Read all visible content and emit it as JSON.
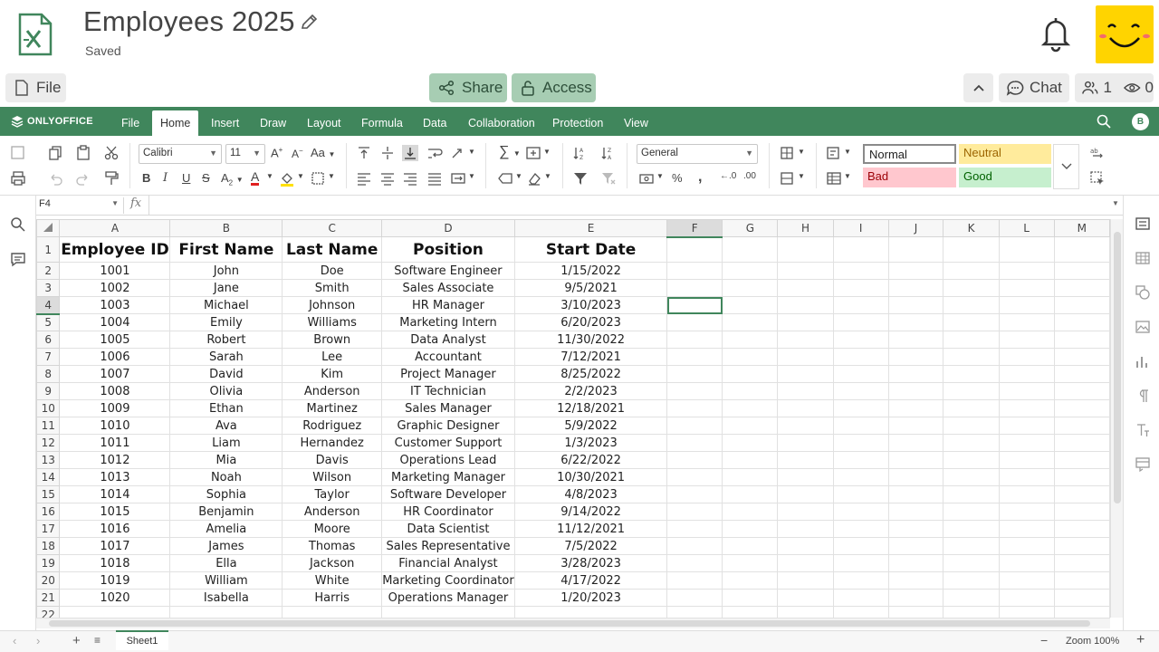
{
  "header": {
    "title": "Employees 2025",
    "status": "Saved",
    "file_label": "File",
    "share_label": "Share",
    "access_label": "Access",
    "chat_label": "Chat",
    "users_count": "1",
    "viewers_count": "0"
  },
  "menu": {
    "brand": "ONLYOFFICE",
    "tabs": [
      "File",
      "Home",
      "Insert",
      "Draw",
      "Layout",
      "Formula",
      "Data",
      "Collaboration",
      "Protection",
      "View"
    ],
    "active_tab": "Home",
    "user_initial": "B"
  },
  "toolbar": {
    "font_name": "Calibri",
    "font_size": "11",
    "number_format": "General",
    "cell_styles": [
      "Normal",
      "Neutral",
      "Bad",
      "Good"
    ]
  },
  "formula_bar": {
    "cell_ref": "F4",
    "fx": "fx",
    "value": ""
  },
  "sheet": {
    "columns": [
      "A",
      "B",
      "C",
      "D",
      "E",
      "F",
      "G",
      "H",
      "I",
      "J",
      "K",
      "L",
      "M"
    ],
    "selected_column": "F",
    "selected_row": "4",
    "header_row": [
      "Employee ID",
      "First Name",
      "Last Name",
      "Position",
      "Start Date"
    ],
    "rows": [
      [
        "1001",
        "John",
        "Doe",
        "Software Engineer",
        "1/15/2022"
      ],
      [
        "1002",
        "Jane",
        "Smith",
        "Sales Associate",
        "9/5/2021"
      ],
      [
        "1003",
        "Michael",
        "Johnson",
        "HR Manager",
        "3/10/2023"
      ],
      [
        "1004",
        "Emily",
        "Williams",
        "Marketing Intern",
        "6/20/2023"
      ],
      [
        "1005",
        "Robert",
        "Brown",
        "Data Analyst",
        "11/30/2022"
      ],
      [
        "1006",
        "Sarah",
        "Lee",
        "Accountant",
        "7/12/2021"
      ],
      [
        "1007",
        "David",
        "Kim",
        "Project Manager",
        "8/25/2022"
      ],
      [
        "1008",
        "Olivia",
        "Anderson",
        "IT Technician",
        "2/2/2023"
      ],
      [
        "1009",
        "Ethan",
        "Martinez",
        "Sales Manager",
        "12/18/2021"
      ],
      [
        "1010",
        "Ava",
        "Rodriguez",
        "Graphic Designer",
        "5/9/2022"
      ],
      [
        "1011",
        "Liam",
        "Hernandez",
        "Customer Support",
        "1/3/2023"
      ],
      [
        "1012",
        "Mia",
        "Davis",
        "Operations Lead",
        "6/22/2022"
      ],
      [
        "1013",
        "Noah",
        "Wilson",
        "Marketing Manager",
        "10/30/2021"
      ],
      [
        "1014",
        "Sophia",
        "Taylor",
        "Software Developer",
        "4/8/2023"
      ],
      [
        "1015",
        "Benjamin",
        "Anderson",
        "HR Coordinator",
        "9/14/2022"
      ],
      [
        "1016",
        "Amelia",
        "Moore",
        "Data Scientist",
        "11/12/2021"
      ],
      [
        "1017",
        "James",
        "Thomas",
        "Sales Representative",
        "7/5/2022"
      ],
      [
        "1018",
        "Ella",
        "Jackson",
        "Financial Analyst",
        "3/28/2023"
      ],
      [
        "1019",
        "William",
        "White",
        "Marketing Coordinator",
        "4/17/2022"
      ],
      [
        "1020",
        "Isabella",
        "Harris",
        "Operations Manager",
        "1/20/2023"
      ]
    ],
    "last_row_number": "22"
  },
  "status": {
    "sheet_name": "Sheet1",
    "zoom": "Zoom 100%"
  },
  "colors": {
    "accent": "#40865c",
    "share_bg": "#a7cdb3",
    "neutral_bg": "#ffeb9c",
    "bad_bg": "#ffc7ce",
    "good_bg": "#c6efce",
    "avatar_bg": "#ffd400"
  }
}
